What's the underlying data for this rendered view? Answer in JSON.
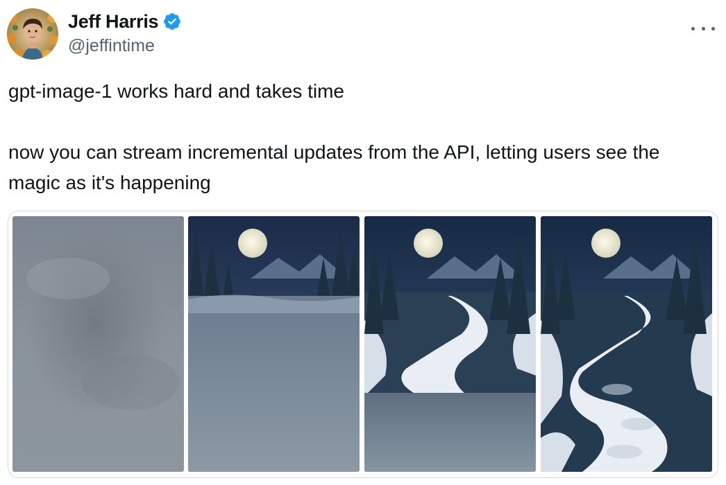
{
  "author": {
    "display_name": "Jeff Harris",
    "handle": "@jeffintime",
    "verified": true,
    "verified_color": "#1d9bf0"
  },
  "tweet": {
    "line1": "gpt-image-1 works hard and takes time",
    "line2": "now you can stream incremental updates from the API, letting users see the magic as it's happening"
  },
  "media": {
    "frames": [
      {
        "stage": "blurred-noise"
      },
      {
        "stage": "sky-and-forest-with-blur"
      },
      {
        "stage": "partial-river"
      },
      {
        "stage": "complete"
      }
    ]
  },
  "icons": {
    "more": "more-options-icon",
    "verified": "verified-badge-icon"
  }
}
